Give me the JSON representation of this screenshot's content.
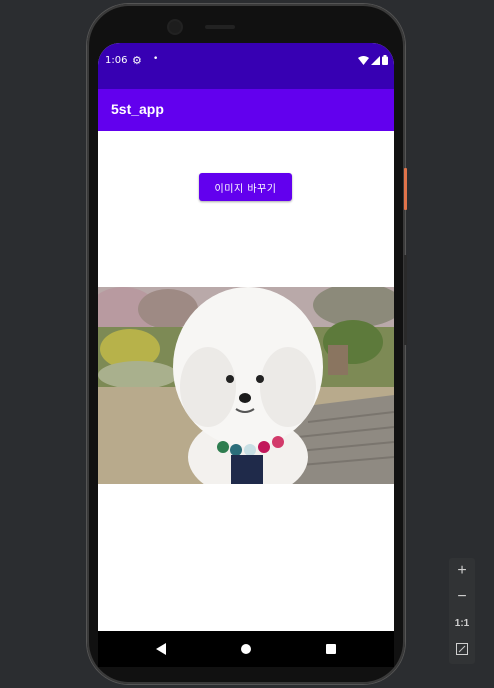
{
  "status_bar": {
    "time": "1:06",
    "icons": [
      "gear-icon",
      "dot-icon",
      "wifi-icon",
      "signal-icon",
      "battery-icon"
    ]
  },
  "app_bar": {
    "title": "5st_app"
  },
  "main": {
    "change_image_button": "이미지 바꾸기"
  },
  "emulator_tools": {
    "zoom_in": "+",
    "zoom_out": "−",
    "one_to_one": "1:1"
  },
  "colors": {
    "status_bar": "#3700b3",
    "app_bar": "#6200ee",
    "button": "#6200ee"
  }
}
